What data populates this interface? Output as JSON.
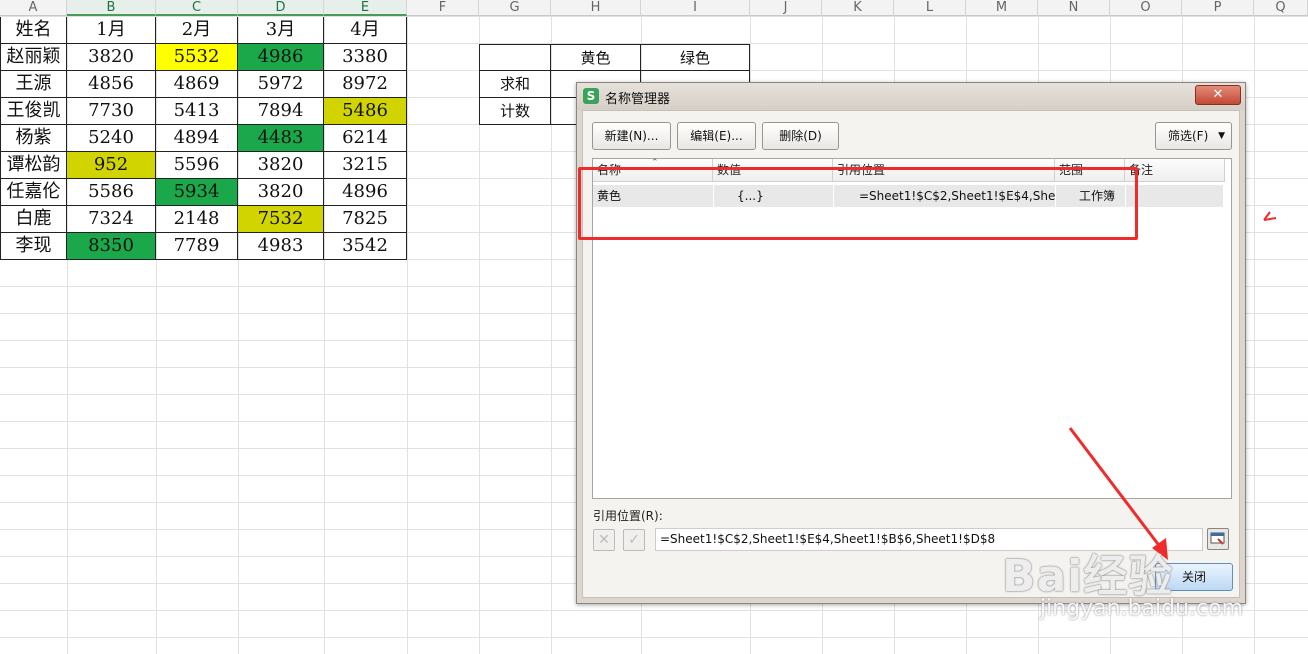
{
  "columns": [
    "A",
    "B",
    "C",
    "D",
    "E",
    "F",
    "G",
    "H",
    "I",
    "J",
    "K",
    "L",
    "M",
    "N",
    "O",
    "P",
    "Q"
  ],
  "table": {
    "header": [
      "姓名",
      "1月",
      "2月",
      "3月",
      "4月"
    ],
    "rows": [
      {
        "name": "赵丽颖",
        "values": [
          "3820",
          "5532",
          "4986",
          "3380"
        ]
      },
      {
        "name": "王源",
        "values": [
          "4856",
          "4869",
          "5972",
          "8972"
        ]
      },
      {
        "name": "王俊凯",
        "values": [
          "7730",
          "5413",
          "7894",
          "5486"
        ]
      },
      {
        "name": "杨紫",
        "values": [
          "5240",
          "4894",
          "4483",
          "6214"
        ]
      },
      {
        "name": "谭松韵",
        "values": [
          "952",
          "5596",
          "3820",
          "3215"
        ]
      },
      {
        "name": "任嘉伦",
        "values": [
          "5586",
          "5934",
          "3820",
          "4896"
        ]
      },
      {
        "name": "白鹿",
        "values": [
          "7324",
          "2148",
          "7532",
          "7825"
        ]
      },
      {
        "name": "李现",
        "values": [
          "8350",
          "7789",
          "4983",
          "3542"
        ]
      }
    ]
  },
  "summary": {
    "header_yellow": "黄色",
    "header_green": "绿色",
    "row_sum": "求和",
    "row_count": "计数"
  },
  "colors": {
    "yellow": "#ffff00",
    "olive": "#d2d400",
    "green": "#1aa84a",
    "annotation_red": "#ef2b2b"
  },
  "dialog": {
    "title": "名称管理器",
    "app_icon": "S",
    "close_icon": "✕",
    "buttons": {
      "new": "新建(N)...",
      "edit": "编辑(E)...",
      "delete": "删除(D)",
      "filter": "筛选(F)"
    },
    "list_headers": {
      "name": "名称",
      "value": "数值",
      "ref": "引用位置",
      "scope": "范围",
      "note": "备注"
    },
    "list_row": {
      "name": "黄色",
      "value": "{...}",
      "ref": "=Sheet1!$C$2,Sheet1!$E$4,She...",
      "scope": "工作簿"
    },
    "ref_label": "引用位置(R):",
    "ref_value": "=Sheet1!$C$2,Sheet1!$E$4,Sheet1!$B$6,Sheet1!$D$8",
    "close_button": "关闭"
  },
  "watermark": {
    "brand": "Bai经验",
    "url": "jingyan.baidu.com"
  }
}
